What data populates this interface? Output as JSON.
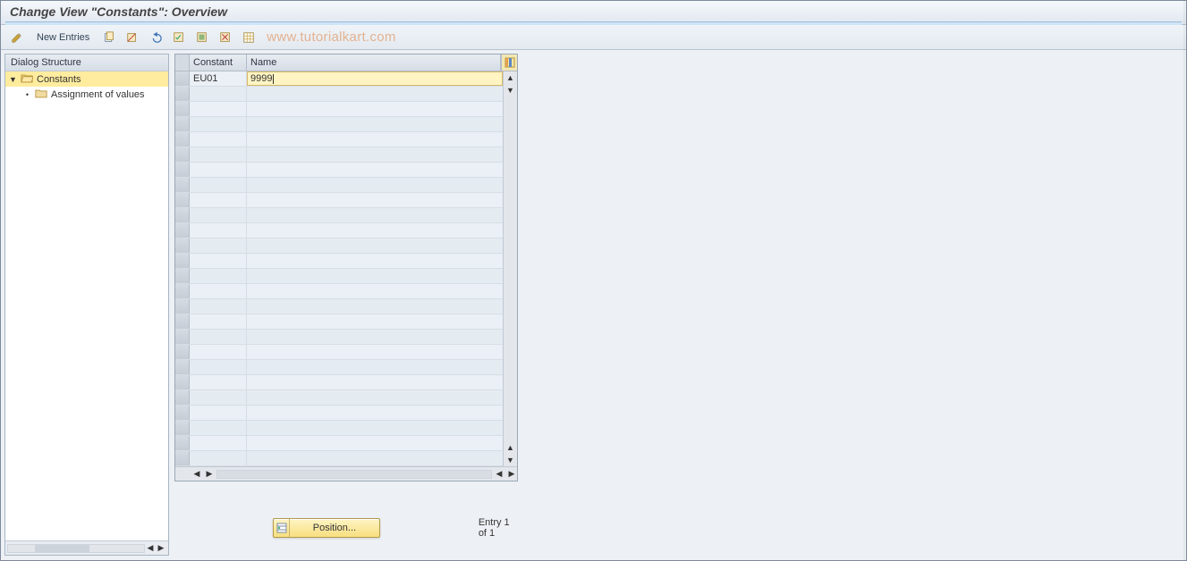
{
  "title": "Change View \"Constants\": Overview",
  "watermark": "www.tutorialkart.com",
  "toolbar": {
    "new_entries_label": "New Entries"
  },
  "sidebar": {
    "header": "Dialog Structure",
    "items": [
      {
        "label": "Constants",
        "selected": true,
        "expandable": true
      },
      {
        "label": "Assignment of values",
        "selected": false,
        "expandable": false
      }
    ]
  },
  "grid": {
    "columns": {
      "constant": "Constant",
      "name": "Name"
    },
    "rows": [
      {
        "constant": "EU01",
        "name": "9999",
        "editing": true
      }
    ],
    "blank_rows": 25
  },
  "footer": {
    "position_label": "Position...",
    "entry_text": "Entry 1 of 1"
  }
}
